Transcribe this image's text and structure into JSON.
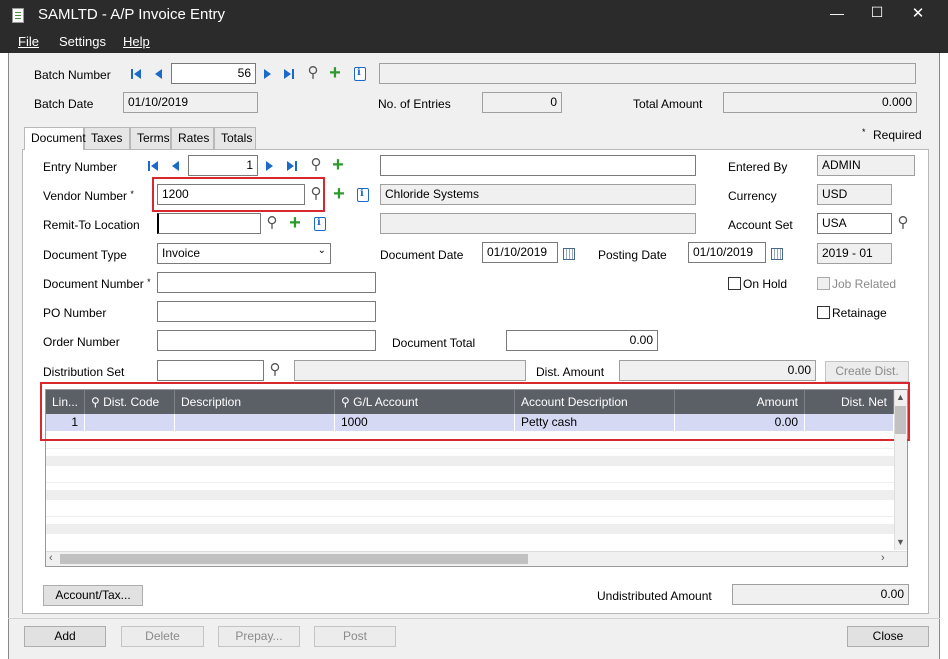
{
  "window": {
    "title": "SAMLTD - A/P Invoice Entry",
    "minimize": "—",
    "maximize": "☐",
    "close": "✕"
  },
  "menu": {
    "file": "File",
    "settings": "Settings",
    "help": "Help"
  },
  "batch": {
    "number_label": "Batch Number",
    "number_value": "56",
    "description_value": "",
    "date_label": "Batch Date",
    "date_value": "01/10/2019",
    "entries_label": "No. of Entries",
    "entries_value": "0",
    "total_label": "Total Amount",
    "total_value": "0.000"
  },
  "tabs": [
    "Document",
    "Taxes",
    "Terms",
    "Rates",
    "Totals"
  ],
  "required_note": "Required",
  "required_mark": "*",
  "form": {
    "entry_number_label": "Entry Number",
    "entry_number_value": "1",
    "entry_desc_value": "",
    "entered_by_label": "Entered By",
    "entered_by_value": "ADMIN",
    "vendor_label": "Vendor Number",
    "vendor_value": "1200",
    "vendor_name": "Chloride Systems",
    "currency_label": "Currency",
    "currency_value": "USD",
    "remit_label": "Remit-To Location",
    "remit_value": "",
    "remit_desc": "",
    "account_set_label": "Account Set",
    "account_set_value": "USA",
    "doc_type_label": "Document Type",
    "doc_type_value": "Invoice",
    "doc_date_label": "Document Date",
    "doc_date_value": "01/10/2019",
    "posting_date_label": "Posting Date",
    "posting_date_value": "01/10/2019",
    "period_value": "2019 - 01",
    "doc_number_label": "Document Number",
    "doc_number_value": "",
    "on_hold_label": "On Hold",
    "job_related_label": "Job Related",
    "po_label": "PO Number",
    "po_value": "",
    "retainage_label": "Retainage",
    "order_label": "Order Number",
    "order_value": "",
    "doc_total_label": "Document Total",
    "doc_total_value": "0.00",
    "dist_set_label": "Distribution Set",
    "dist_set_value": "",
    "dist_set_desc": "",
    "dist_amount_label": "Dist. Amount",
    "dist_amount_value": "0.00",
    "create_dist_label": "Create Dist."
  },
  "grid": {
    "headers": [
      "Lin...",
      "Dist. Code",
      "Description",
      "G/L Account",
      "Account Description",
      "Amount",
      "Dist. Net"
    ],
    "rows": [
      {
        "line": "1",
        "dist_code": "",
        "description": "",
        "gl_account": "1000",
        "account_description": "Petty cash",
        "amount": "0.00",
        "dist_net": ""
      }
    ]
  },
  "footer": {
    "account_tax_label": "Account/Tax...",
    "undistributed_label": "Undistributed Amount",
    "undistributed_value": "0.00",
    "add": "Add",
    "delete": "Delete",
    "prepay": "Prepay...",
    "post": "Post",
    "close": "Close"
  }
}
